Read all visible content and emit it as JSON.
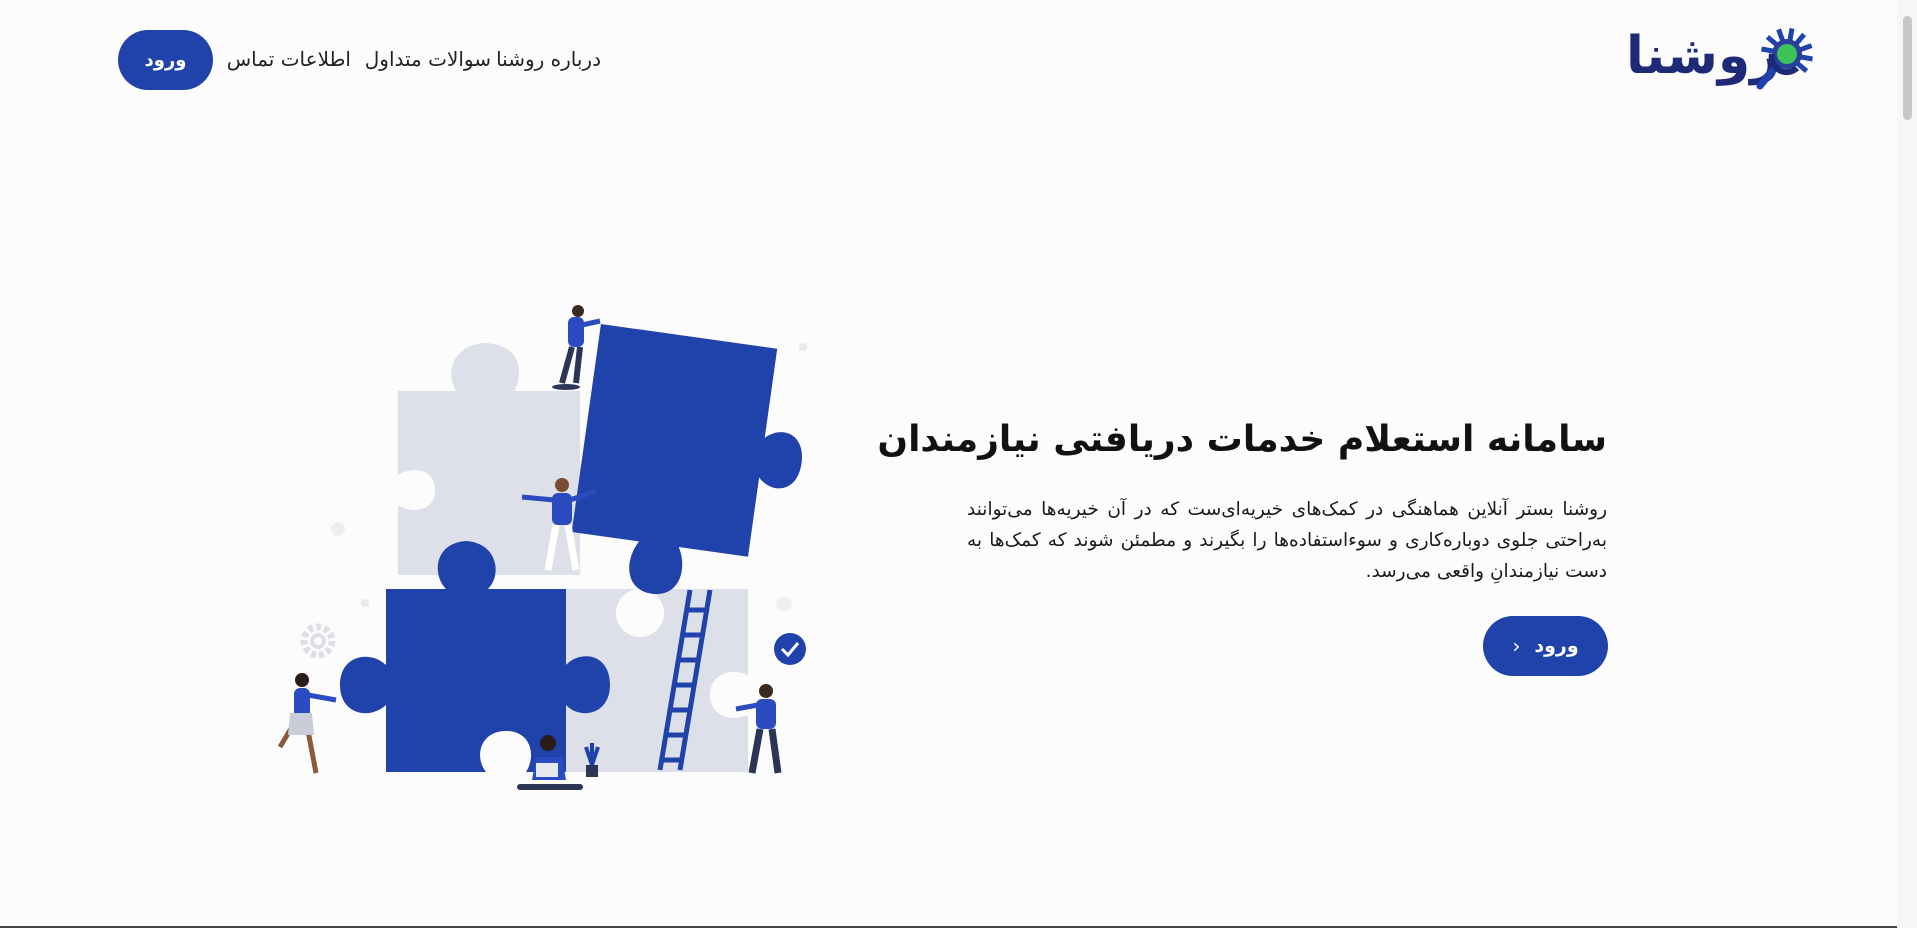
{
  "brand": {
    "logo_text": "روشنا",
    "primary_color": "#1f43aa",
    "logo_color": "#1e2a78",
    "accent_green": "#3cc45a"
  },
  "nav": {
    "about_label": "درباره روشنا",
    "faq_label": "سوالات متداول",
    "contact_label": "اطلاعات تماس",
    "login_label": "ورود"
  },
  "hero": {
    "title": "سامانه استعلام خدمات دریافتی نیازمندان",
    "description": "روشنا بستر آنلاین هماهنگی در کمک‌های خیریه‌ای‌ست که در آن خیریه‌ها می‌توانند به‌راحتی جلوی دوباره‌کاری و سوءاستفاده‌ها را بگیرند و مطمئن شوند که کمک‌ها به دست نیازمندانِ واقعی می‌رسد.",
    "cta_label": "ورود",
    "cta_icon": "chevron-left-icon"
  },
  "illustration": {
    "subject": "puzzle-teamwork-illustration",
    "icons": [
      "gear-icon",
      "checkmark-badge-icon",
      "ladder-icon",
      "plant-icon"
    ]
  }
}
